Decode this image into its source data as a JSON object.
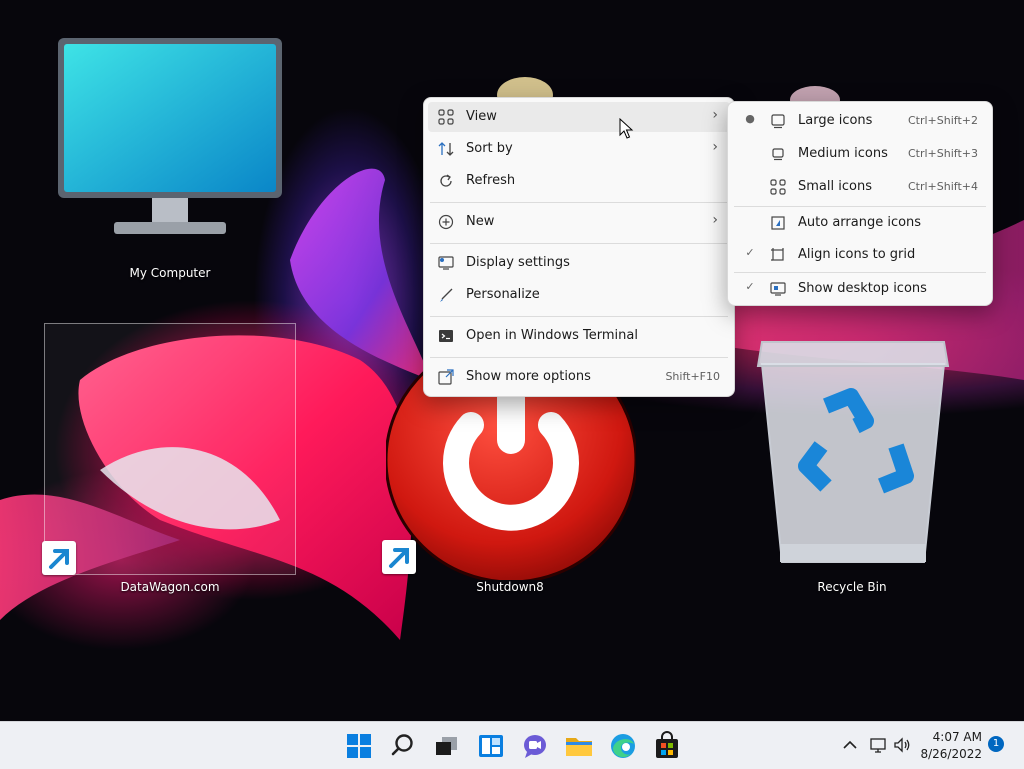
{
  "desktop": {
    "icons": [
      {
        "label": "My Computer"
      },
      {
        "label": "DataWagon.com"
      },
      {
        "label": "Shutdown8"
      },
      {
        "label": "Recycle Bin"
      }
    ]
  },
  "context_menu": {
    "items": [
      {
        "label": "View",
        "icon": "view-grid-icon",
        "has_submenu": true
      },
      {
        "label": "Sort by",
        "icon": "sort-icon",
        "has_submenu": true
      },
      {
        "label": "Refresh",
        "icon": "refresh-icon"
      },
      {
        "label": "New",
        "icon": "new-plus-icon",
        "has_submenu": true
      },
      {
        "label": "Display settings",
        "icon": "display-settings-icon"
      },
      {
        "label": "Personalize",
        "icon": "personalize-brush-icon"
      },
      {
        "label": "Open in Windows Terminal",
        "icon": "terminal-icon"
      },
      {
        "label": "Show more options",
        "icon": "more-options-icon",
        "shortcut": "Shift+F10"
      }
    ]
  },
  "view_submenu": {
    "items": [
      {
        "label": "Large icons",
        "shortcut": "Ctrl+Shift+2",
        "state": "bullet"
      },
      {
        "label": "Medium icons",
        "shortcut": "Ctrl+Shift+3",
        "state": ""
      },
      {
        "label": "Small icons",
        "shortcut": "Ctrl+Shift+4",
        "state": ""
      },
      {
        "label": "Auto arrange icons",
        "state": ""
      },
      {
        "label": "Align icons to grid",
        "state": "check"
      },
      {
        "label": "Show desktop icons",
        "state": "check"
      }
    ]
  },
  "taskbar": {
    "apps": [
      "start-icon",
      "search-icon",
      "task-view-icon",
      "widgets-icon",
      "chat-icon",
      "file-explorer-icon",
      "edge-icon",
      "store-icon"
    ],
    "time": "4:07 AM",
    "date": "8/26/2022",
    "notification_count": "1"
  },
  "colors": {
    "accent": "#0067c0",
    "menu_bg": "#f9f9f9",
    "taskbar_bg": "#eef0f4"
  }
}
